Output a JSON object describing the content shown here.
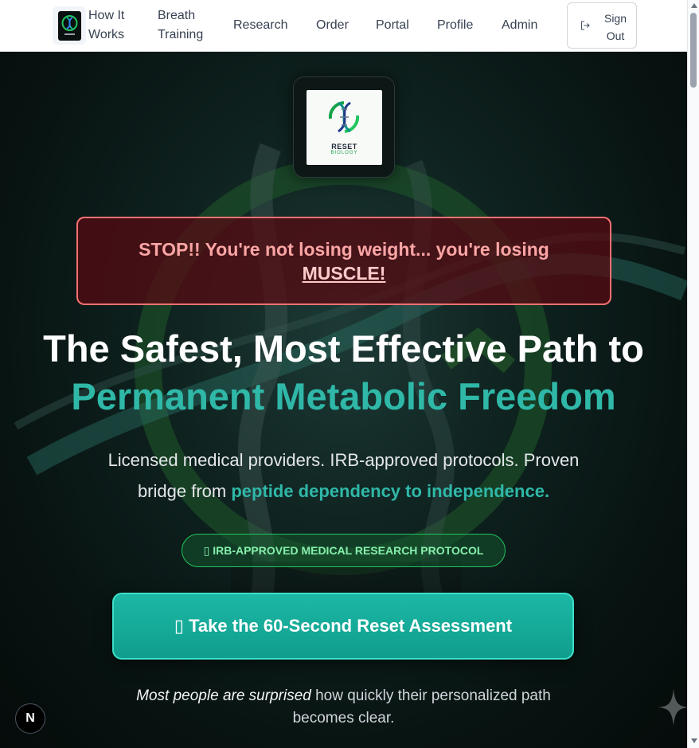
{
  "nav": {
    "how_it_works": "How It Works",
    "breath_training": "Breath Training",
    "research": "Research",
    "order": "Order",
    "portal": "Portal",
    "profile": "Profile",
    "admin": "Admin",
    "sign_out": "Sign Out"
  },
  "hero": {
    "brand_line1": "RESET",
    "brand_line2": "BIOLOGY",
    "alert_line": "STOP!! You're not losing weight... you're losing",
    "alert_emphasis": "MUSCLE!",
    "headline_line1": "The Safest, Most Effective Path to",
    "headline_line2": "Permanent Metabolic Freedom",
    "sub_line1": "Licensed medical providers. IRB-approved protocols. Proven",
    "sub_line2_prefix": "bridge from ",
    "sub_line2_accent": "peptide dependency to independence.",
    "badge": "IRB-APPROVED MEDICAL RESEARCH PROTOCOL",
    "cta": "Take the 60-Second Reset Assessment",
    "foot_emphasis": "Most people are surprised",
    "foot_rest": " how quickly their personalized path",
    "foot_line2": "becomes clear."
  },
  "dev_overlay": {
    "label": "N"
  },
  "colors": {
    "accent_teal": "#2fb8a8",
    "alert_red": "#f87171",
    "badge_green": "#22c55e",
    "cta": "#1cb7a5"
  },
  "icons": [
    "logo-icon",
    "sign-out-icon",
    "brand-logo-icon",
    "shield-icon",
    "clipboard-icon",
    "sparkle-icon"
  ]
}
